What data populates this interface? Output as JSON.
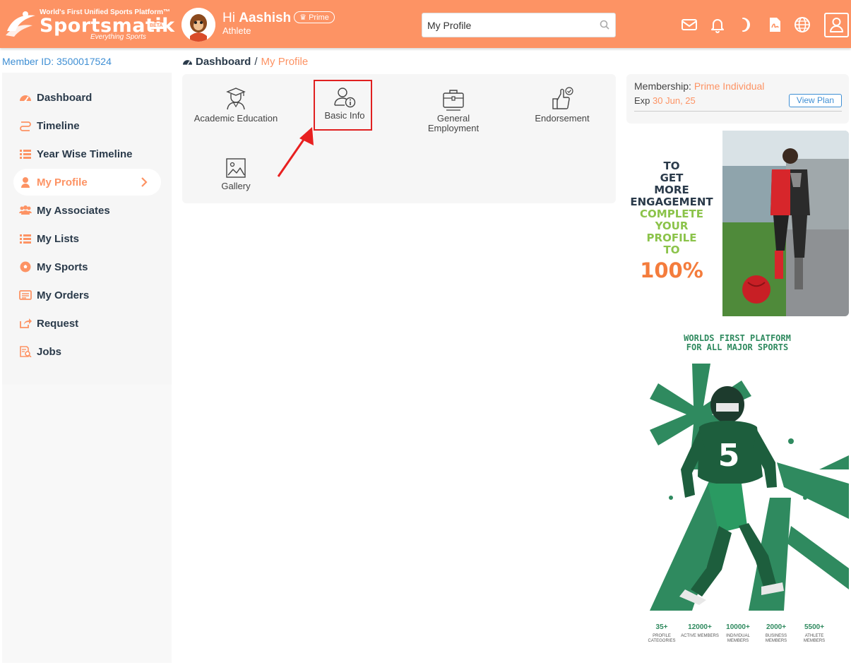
{
  "header": {
    "tagline": "World's First Unified Sports Platform™",
    "brand": "Sportsmatik",
    "beta": "BETA",
    "slogan": "Everything Sports",
    "greeting_hi": "Hi",
    "user_name": "Aashish",
    "badge": "Prime",
    "role": "Athlete",
    "search_value": "My Profile",
    "icons": [
      "mail-icon",
      "bell-icon",
      "moon-icon",
      "pdf-icon",
      "globe-icon",
      "user-icon"
    ]
  },
  "member_id": "Member ID: 3500017524",
  "sidebar": {
    "items": [
      {
        "label": "Dashboard",
        "icon": "dashboard-icon"
      },
      {
        "label": "Timeline",
        "icon": "timeline-icon"
      },
      {
        "label": "Year Wise Timeline",
        "icon": "list-icon"
      },
      {
        "label": "My Profile",
        "icon": "user-icon",
        "active": true
      },
      {
        "label": "My Associates",
        "icon": "users-icon"
      },
      {
        "label": "My Lists",
        "icon": "list-icon"
      },
      {
        "label": "My Sports",
        "icon": "ball-icon"
      },
      {
        "label": "My Orders",
        "icon": "orders-icon"
      },
      {
        "label": "Request",
        "icon": "share-icon"
      },
      {
        "label": "Jobs",
        "icon": "jobs-icon"
      }
    ]
  },
  "breadcrumb": {
    "home": "Dashboard",
    "sep": "/",
    "current": "My Profile"
  },
  "tiles": [
    {
      "label": "Academic Education",
      "icon": "graduate-icon"
    },
    {
      "label": "Basic Info",
      "icon": "user-info-icon"
    },
    {
      "label": "General Employment",
      "icon": "briefcase-icon"
    },
    {
      "label": "Endorsement",
      "icon": "thumbs-up-icon"
    },
    {
      "label": "Gallery",
      "icon": "image-icon"
    }
  ],
  "membership": {
    "label": "Membership:",
    "plan": "Prime Individual",
    "exp_label": "Exp",
    "exp_date": "30 Jun, 25",
    "view_plan": "View Plan"
  },
  "promo1": {
    "l1": "TO",
    "l2": "GET",
    "l3": "MORE",
    "l4": "ENGAGEMENT",
    "l5": "COMPLETE",
    "l6": "YOUR",
    "l7": "PROFILE",
    "l8": "TO",
    "big": "100%"
  },
  "promo2": {
    "head1": "WORLDS FIRST PLATFORM",
    "head2": "FOR ALL MAJOR SPORTS",
    "jersey_number": "5",
    "stats": [
      {
        "n": "35+",
        "l": "PROFILE CATEGORIES"
      },
      {
        "n": "12000+",
        "l": "ACTIVE MEMBERS"
      },
      {
        "n": "10000+",
        "l": "INDIVIDUAL MEMBERS"
      },
      {
        "n": "2000+",
        "l": "BUSINESS MEMBERS"
      },
      {
        "n": "5500+",
        "l": "ATHLETE MEMBERS"
      }
    ]
  },
  "colors": {
    "brand": "#fd9364",
    "link": "#3f8fd4",
    "highlight": "#e02020",
    "green": "#2f8a5f"
  }
}
